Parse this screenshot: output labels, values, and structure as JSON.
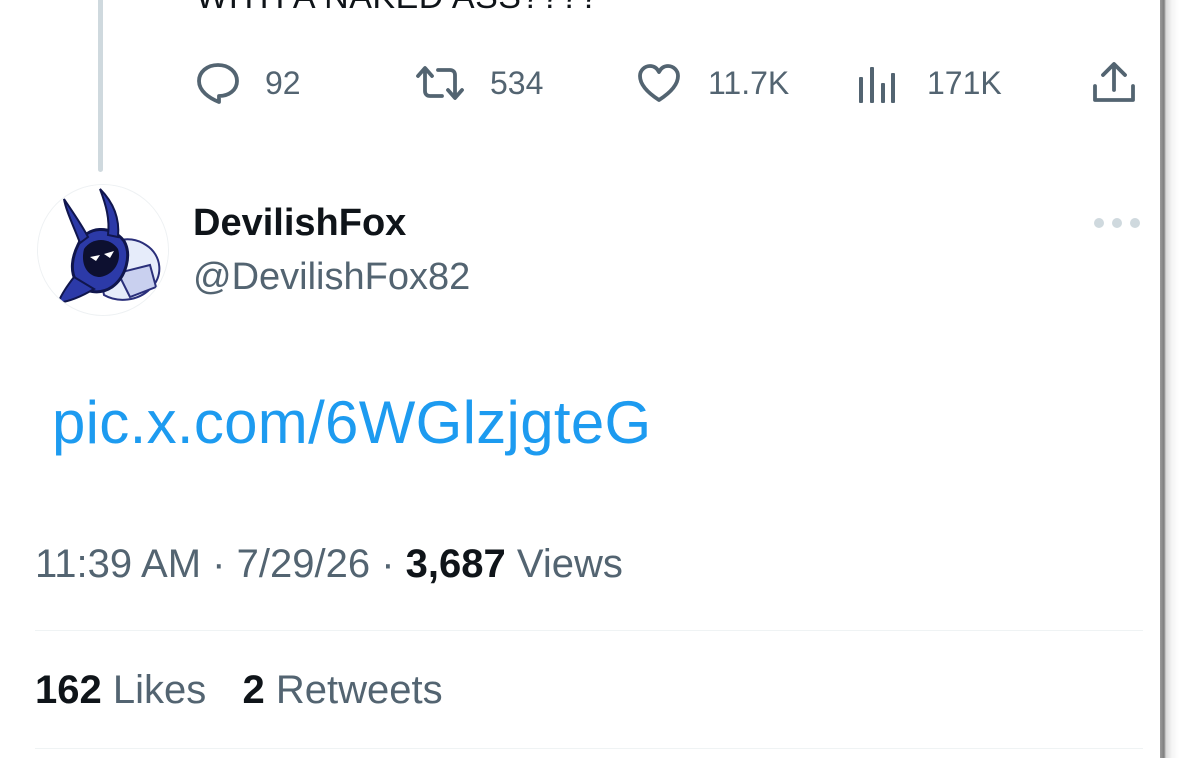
{
  "previous_tweet": {
    "cut_text": "WITH A NAKED ASS????",
    "actions": {
      "replies": "92",
      "retweets": "534",
      "likes": "11.7K",
      "views": "171K"
    }
  },
  "tweet": {
    "display_name": "DevilishFox",
    "handle": "@DevilishFox82",
    "link_text": "pic.x.com/6WGlzjgteG",
    "time": "11:39 AM",
    "date": "7/29/26",
    "separator": "·",
    "views_count": "3,687",
    "views_label": "Views",
    "likes_count": "162",
    "likes_label": "Likes",
    "retweets_count": "2",
    "retweets_label": "Retweets"
  },
  "icons": {
    "reply": "speech-bubble-icon",
    "retweet": "retweet-arrows-icon",
    "like": "heart-icon",
    "views": "bar-chart-icon",
    "share": "share-upload-icon",
    "more": "more-dots-icon"
  },
  "colors": {
    "link": "#1d9bf0",
    "secondary_text": "#536471",
    "primary_text": "#0f1419",
    "divider": "#eff3f4"
  }
}
